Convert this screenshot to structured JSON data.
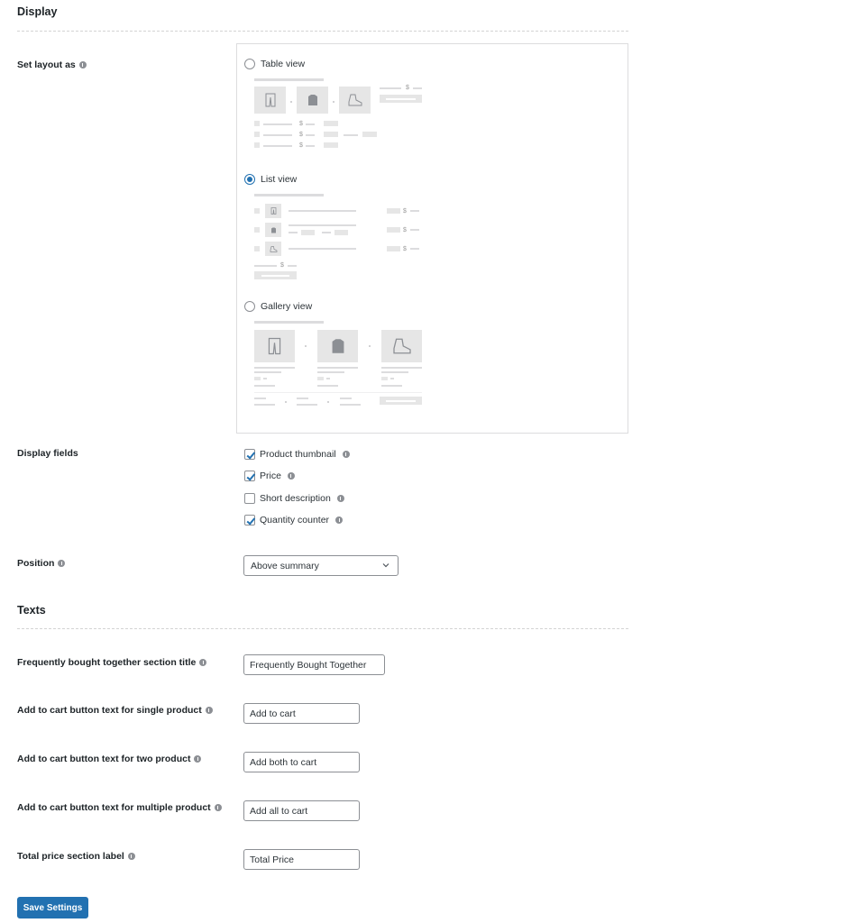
{
  "display": {
    "title": "Display",
    "layout": {
      "label": "Set layout as",
      "selected": "list",
      "options": [
        {
          "id": "table",
          "label": "Table view",
          "checked": false
        },
        {
          "id": "list",
          "label": "List view",
          "checked": true
        },
        {
          "id": "gallery",
          "label": "Gallery view",
          "checked": false
        }
      ],
      "preview_currency_symbol": "$"
    },
    "fields": {
      "label": "Display fields",
      "items": [
        {
          "label": "Product thumbnail",
          "checked": true
        },
        {
          "label": "Price",
          "checked": true
        },
        {
          "label": "Short description",
          "checked": false
        },
        {
          "label": "Quantity counter",
          "checked": true
        }
      ]
    },
    "position": {
      "label": "Position",
      "selected_value": "Above summary"
    }
  },
  "texts": {
    "title": "Texts",
    "rows": [
      {
        "label": "Frequently bought together section title",
        "value": "Frequently Bought Together"
      },
      {
        "label": "Add to cart button text for single product",
        "value": "Add to cart"
      },
      {
        "label": "Add to cart button text for two product",
        "value": "Add both to cart"
      },
      {
        "label": "Add to cart button text for multiple product",
        "value": "Add all to cart"
      },
      {
        "label": "Total price section label",
        "value": "Total Price"
      }
    ]
  },
  "save_button": {
    "label": "Save Settings"
  },
  "colors": {
    "accent": "#2271b1",
    "text": "#1d2327",
    "border": "#8c8f94",
    "placeholder_gray": "#e6e6e6"
  }
}
